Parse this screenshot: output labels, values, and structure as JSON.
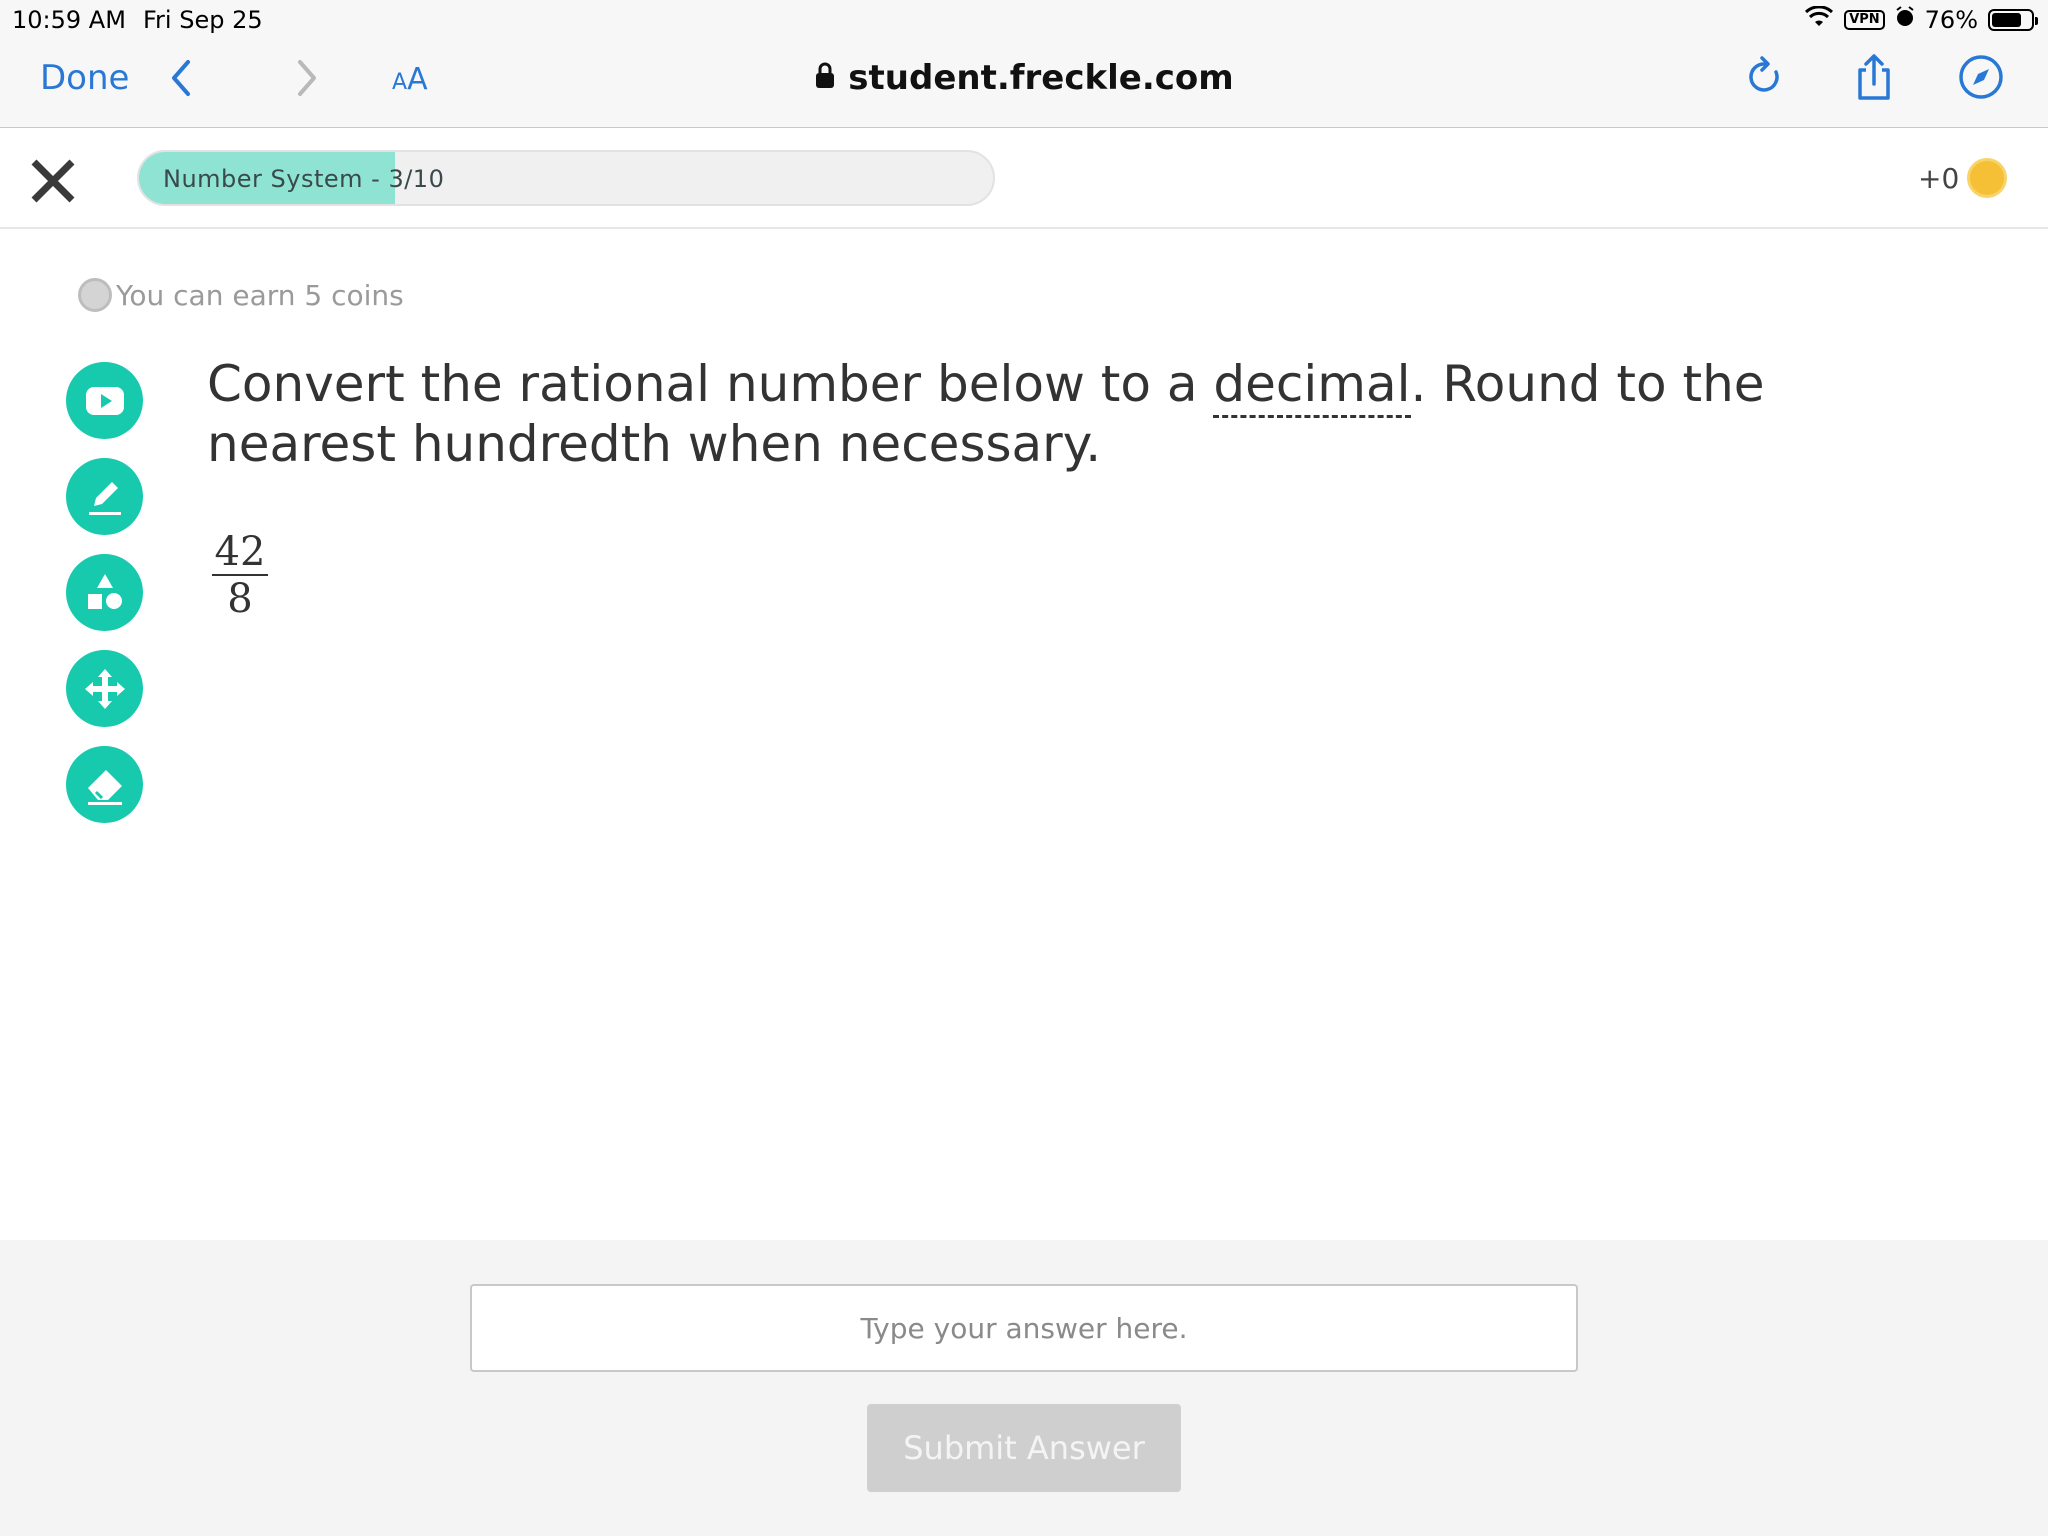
{
  "status_bar": {
    "time": "10:59 AM",
    "date": "Fri Sep 25",
    "vpn": "VPN",
    "battery": "76%",
    "battery_level": 0.76
  },
  "browser": {
    "done_label": "Done",
    "text_size_small": "A",
    "text_size_big": "A",
    "url": "student.freckle.com",
    "icons": [
      "chevron-left-icon",
      "chevron-right-icon",
      "lock-icon",
      "reload-icon",
      "share-icon",
      "compass-icon"
    ],
    "accent_color": "#2a78d6"
  },
  "app_header": {
    "progress_label": "Number System - 3/10",
    "progress_fraction": 0.3,
    "coin_count": "+0"
  },
  "main": {
    "earn_text": "You can earn 5 coins",
    "tools": [
      "video-play-icon",
      "pencil-icon",
      "shapes-icon",
      "move-arrows-icon",
      "eraser-icon"
    ],
    "tool_color": "#17c9ad",
    "question": {
      "part1": "Convert the rational number below to a ",
      "glossary_term": "decimal",
      "part2": ". Round to the nearest hundredth when necessary."
    },
    "fraction": {
      "numerator": "42",
      "denominator": "8"
    }
  },
  "answer": {
    "placeholder": "Type your answer here.",
    "value": "",
    "submit_label": "Submit Answer"
  }
}
